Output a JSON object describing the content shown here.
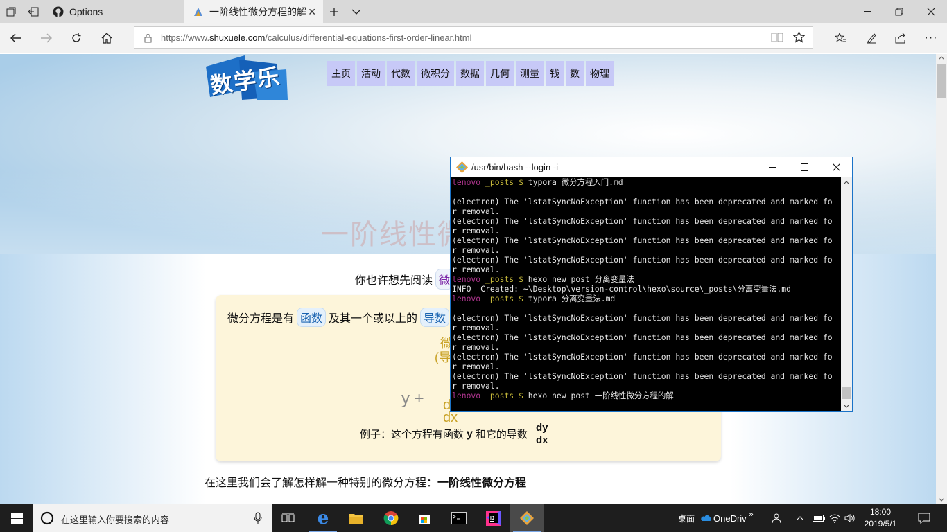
{
  "browser": {
    "tabs": [
      {
        "label": "Options"
      },
      {
        "label": "一阶线性微分方程的解"
      }
    ],
    "url_prefix": "https://www.",
    "url_domain": "shuxuele.com",
    "url_path": "/calculus/differential-equations-first-order-linear.html"
  },
  "page": {
    "logo_text": "数学乐",
    "menu": [
      "主页",
      "活动",
      "代数",
      "微积分",
      "数据",
      "几何",
      "测量",
      "钱",
      "数",
      "物理"
    ],
    "title": "一阶线性微",
    "read_first_prefix": "你也许想先阅读",
    "read_first_link": "微",
    "box": {
      "line1_a": "微分方程是有",
      "link_function": "函数",
      "line1_b": "及其一个或以上的",
      "link_derivative": "导数",
      "gold_1": "微",
      "gold_2": "(导",
      "eq_y": "y  +",
      "eq_frac_num": "d",
      "eq_frac_den": "dx",
      "example_text": "例子：这个方程有函数",
      "example_y": "y",
      "example_mid": "和它的导数",
      "example_num": "dy",
      "example_den": "dx"
    },
    "bottom_text_a": "在这里我们会了解怎样解一种特别的微分方程：",
    "bottom_text_b": "一阶线性微分方程"
  },
  "terminal": {
    "title": "/usr/bin/bash --login -i",
    "lines": [
      {
        "user": "lenovo",
        "dir": " _posts $",
        "cmd": " typora 微分方程入门.md"
      },
      {
        "text": ""
      },
      {
        "text": "(electron) The 'lstatSyncNoException' function has been deprecated and marked fo"
      },
      {
        "text": "r removal."
      },
      {
        "text": "(electron) The 'lstatSyncNoException' function has been deprecated and marked fo"
      },
      {
        "text": "r removal."
      },
      {
        "text": "(electron) The 'lstatSyncNoException' function has been deprecated and marked fo"
      },
      {
        "text": "r removal."
      },
      {
        "text": "(electron) The 'lstatSyncNoException' function has been deprecated and marked fo"
      },
      {
        "text": "r removal."
      },
      {
        "user": "lenovo",
        "dir": " _posts $",
        "cmd": " hexo new post 分离变量法"
      },
      {
        "text": "INFO  Created: ~\\Desktop\\version-control\\hexo\\source\\_posts\\分离变量法.md"
      },
      {
        "user": "lenovo",
        "dir": " _posts $",
        "cmd": " typora 分离变量法.md"
      },
      {
        "text": ""
      },
      {
        "text": "(electron) The 'lstatSyncNoException' function has been deprecated and marked fo"
      },
      {
        "text": "r removal."
      },
      {
        "text": "(electron) The 'lstatSyncNoException' function has been deprecated and marked fo"
      },
      {
        "text": "r removal."
      },
      {
        "text": "(electron) The 'lstatSyncNoException' function has been deprecated and marked fo"
      },
      {
        "text": "r removal."
      },
      {
        "text": "(electron) The 'lstatSyncNoException' function has been deprecated and marked fo"
      },
      {
        "text": "r removal."
      },
      {
        "user": "lenovo",
        "dir": " _posts $",
        "cmd": " hexo new post 一阶线性微分方程的解"
      }
    ]
  },
  "taskbar": {
    "search_placeholder": "在这里输入你要搜索的内容",
    "desktop_label": "桌面",
    "onedrive_label": "OneDriv",
    "time": "18:00",
    "date": "2019/5/1"
  },
  "colors": {
    "menu_bg": "#c7c9f7",
    "terminal_bg": "#000000",
    "prompt_user": "#b0358f",
    "prompt_dir": "#c6b93a",
    "box_bg": "#fdf5da",
    "accent_gold": "#c9a227"
  }
}
